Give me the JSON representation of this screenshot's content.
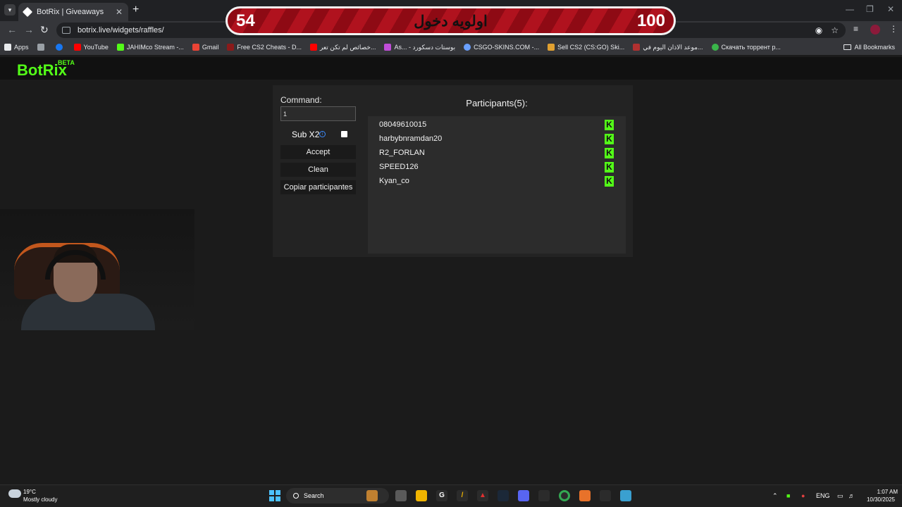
{
  "browser": {
    "tab_title": "BotRix | Giveaways",
    "url": "botrix.live/widgets/raffles/",
    "bookmarks": [
      {
        "label": "Apps",
        "color": "#e8eaed"
      },
      {
        "label": "",
        "color": "#e8eaed"
      },
      {
        "label": "",
        "color": "#1877f2"
      },
      {
        "label": "YouTube",
        "color": "#ff0000"
      },
      {
        "label": "JAHIMco Stream -...",
        "color": "#53fc18"
      },
      {
        "label": "Gmail",
        "color": "#ea4335"
      },
      {
        "label": "Free CS2 Cheats - D...",
        "color": "#8b1a1a"
      },
      {
        "label": "خصائص لم تكن تعر...",
        "color": "#ff0000"
      },
      {
        "label": "As... - بوستات دسكورد",
        "color": "#c04dd8"
      },
      {
        "label": "CSGO-SKINS.COM -...",
        "color": "#6aa0ff"
      },
      {
        "label": "Sell CS2 (CS:GO) Ski...",
        "color": "#e0a030"
      },
      {
        "label": "موعد الاذان اليوم في...",
        "color": "#b03030"
      },
      {
        "label": "Скачать торрент р...",
        "color": "#3ab54a"
      }
    ],
    "all_bookmarks": "All Bookmarks"
  },
  "overlay": {
    "left_number": "54",
    "title": "اولويه دخول",
    "right_number": "100"
  },
  "app": {
    "logo": "BotRix",
    "logo_badge": "BETA",
    "command_label": "Command:",
    "command_value": "1",
    "sub_label": "Sub X2",
    "info_icon": "i",
    "accept_label": "Accept",
    "clean_label": "Clean",
    "copy_label": "Copiar participantes",
    "participants_title": "Participants(5):",
    "participants": [
      {
        "name": "08049610015"
      },
      {
        "name": "harbybnramdan20"
      },
      {
        "name": "R2_FORLAN"
      },
      {
        "name": "SPEED126"
      },
      {
        "name": "Kyan_co"
      }
    ],
    "platform_badge": "K",
    "accent_color": "#53fc18"
  },
  "taskbar": {
    "weather_temp": "19°C",
    "weather_desc": "Mostly cloudy",
    "search_label": "Search",
    "language": "ENG",
    "time": "1:07 AM",
    "date": "10/30/2025"
  }
}
